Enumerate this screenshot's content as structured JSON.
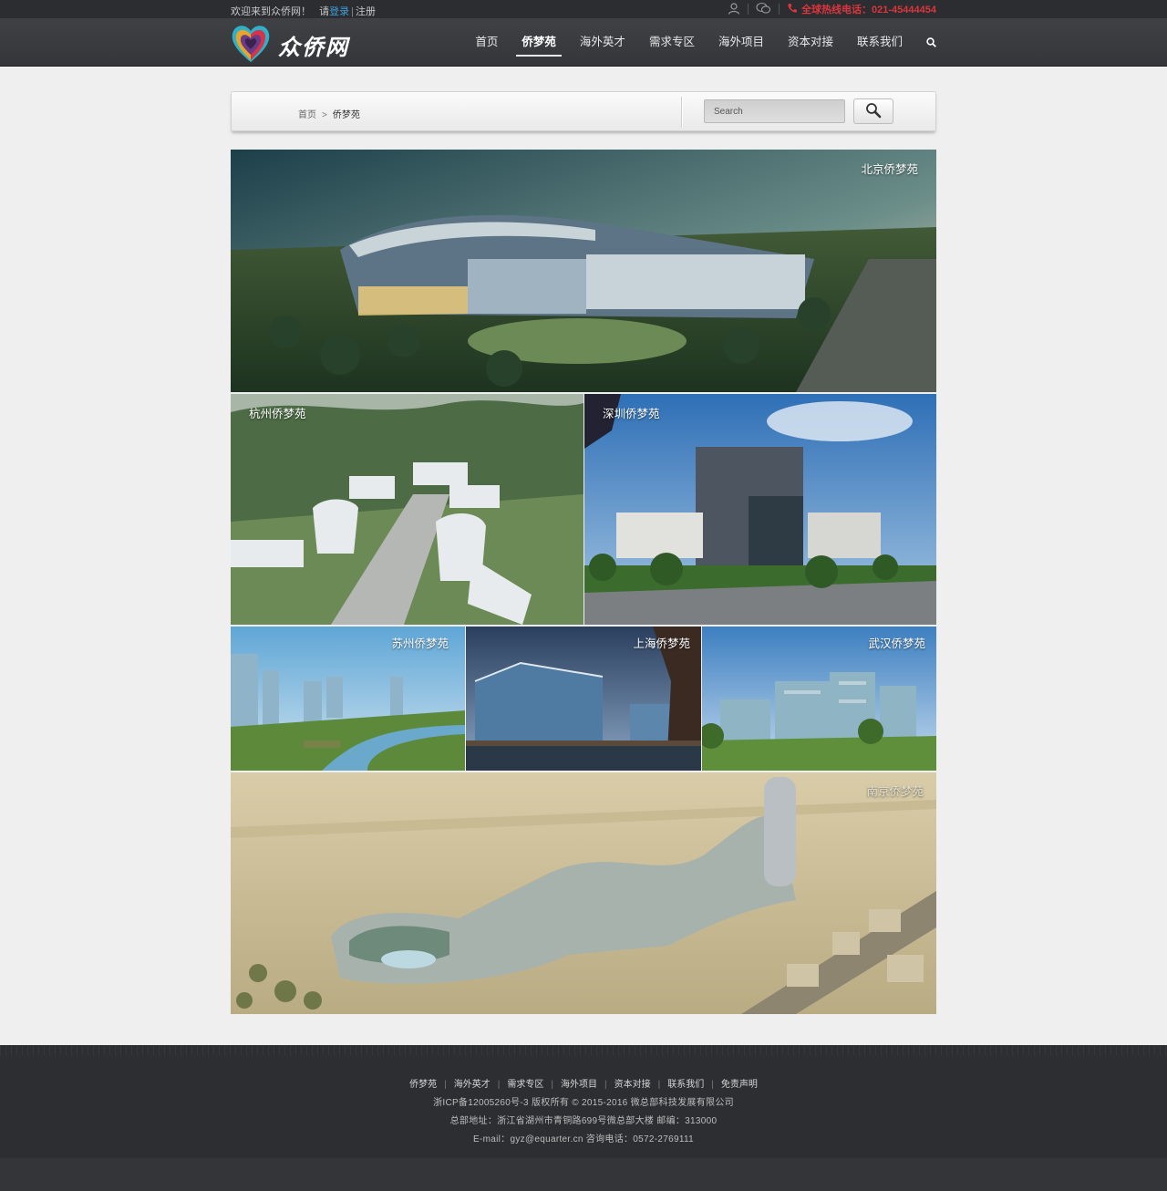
{
  "topbar": {
    "welcome": "欢迎来到众侨网！",
    "please": "请",
    "login": "登录",
    "separator": "|",
    "register": "注册",
    "hotline": "全球热线电话：021-45444454",
    "icons": [
      "user-icon",
      "wechat-icon",
      "phone-icon"
    ]
  },
  "header": {
    "logo_text": "众侨网",
    "nav": [
      {
        "label": "首页",
        "active": false
      },
      {
        "label": "侨梦苑",
        "active": true
      },
      {
        "label": "海外英才",
        "active": false
      },
      {
        "label": "需求专区",
        "active": false
      },
      {
        "label": "海外项目",
        "active": false
      },
      {
        "label": "资本对接",
        "active": false
      },
      {
        "label": "联系我们",
        "active": false
      }
    ]
  },
  "breadcrumb": {
    "home": "首页",
    "arrow": ">",
    "current": "侨梦苑"
  },
  "search": {
    "placeholder": "Search"
  },
  "tiles": [
    {
      "label": "北京侨梦苑"
    },
    {
      "label": "杭州侨梦苑"
    },
    {
      "label": "深圳侨梦苑"
    },
    {
      "label": "苏州侨梦苑"
    },
    {
      "label": "上海侨梦苑"
    },
    {
      "label": "武汉侨梦苑"
    },
    {
      "label": "南京侨梦苑"
    }
  ],
  "footer": {
    "links": [
      "侨梦苑",
      "海外英才",
      "需求专区",
      "海外项目",
      "资本对接",
      "联系我们",
      "免责声明"
    ],
    "link_separator": "|",
    "copyright": "浙ICP备12005260号-3 版权所有 © 2015-2016 微总部科技发展有限公司",
    "address": "总部地址：浙江省湖州市青铜路699号微总部大楼   邮编：313000",
    "contact": "E-mail：gyz@equarter.cn   咨询电话：0572-2769111"
  },
  "colors": {
    "topbar_bg": "#2b2d30",
    "header_bg": "#3a3c40",
    "hotline": "#d9363e",
    "login_link": "#3ea0e0",
    "page_bg": "#efefef",
    "footer_bg": "#2c2e31"
  }
}
